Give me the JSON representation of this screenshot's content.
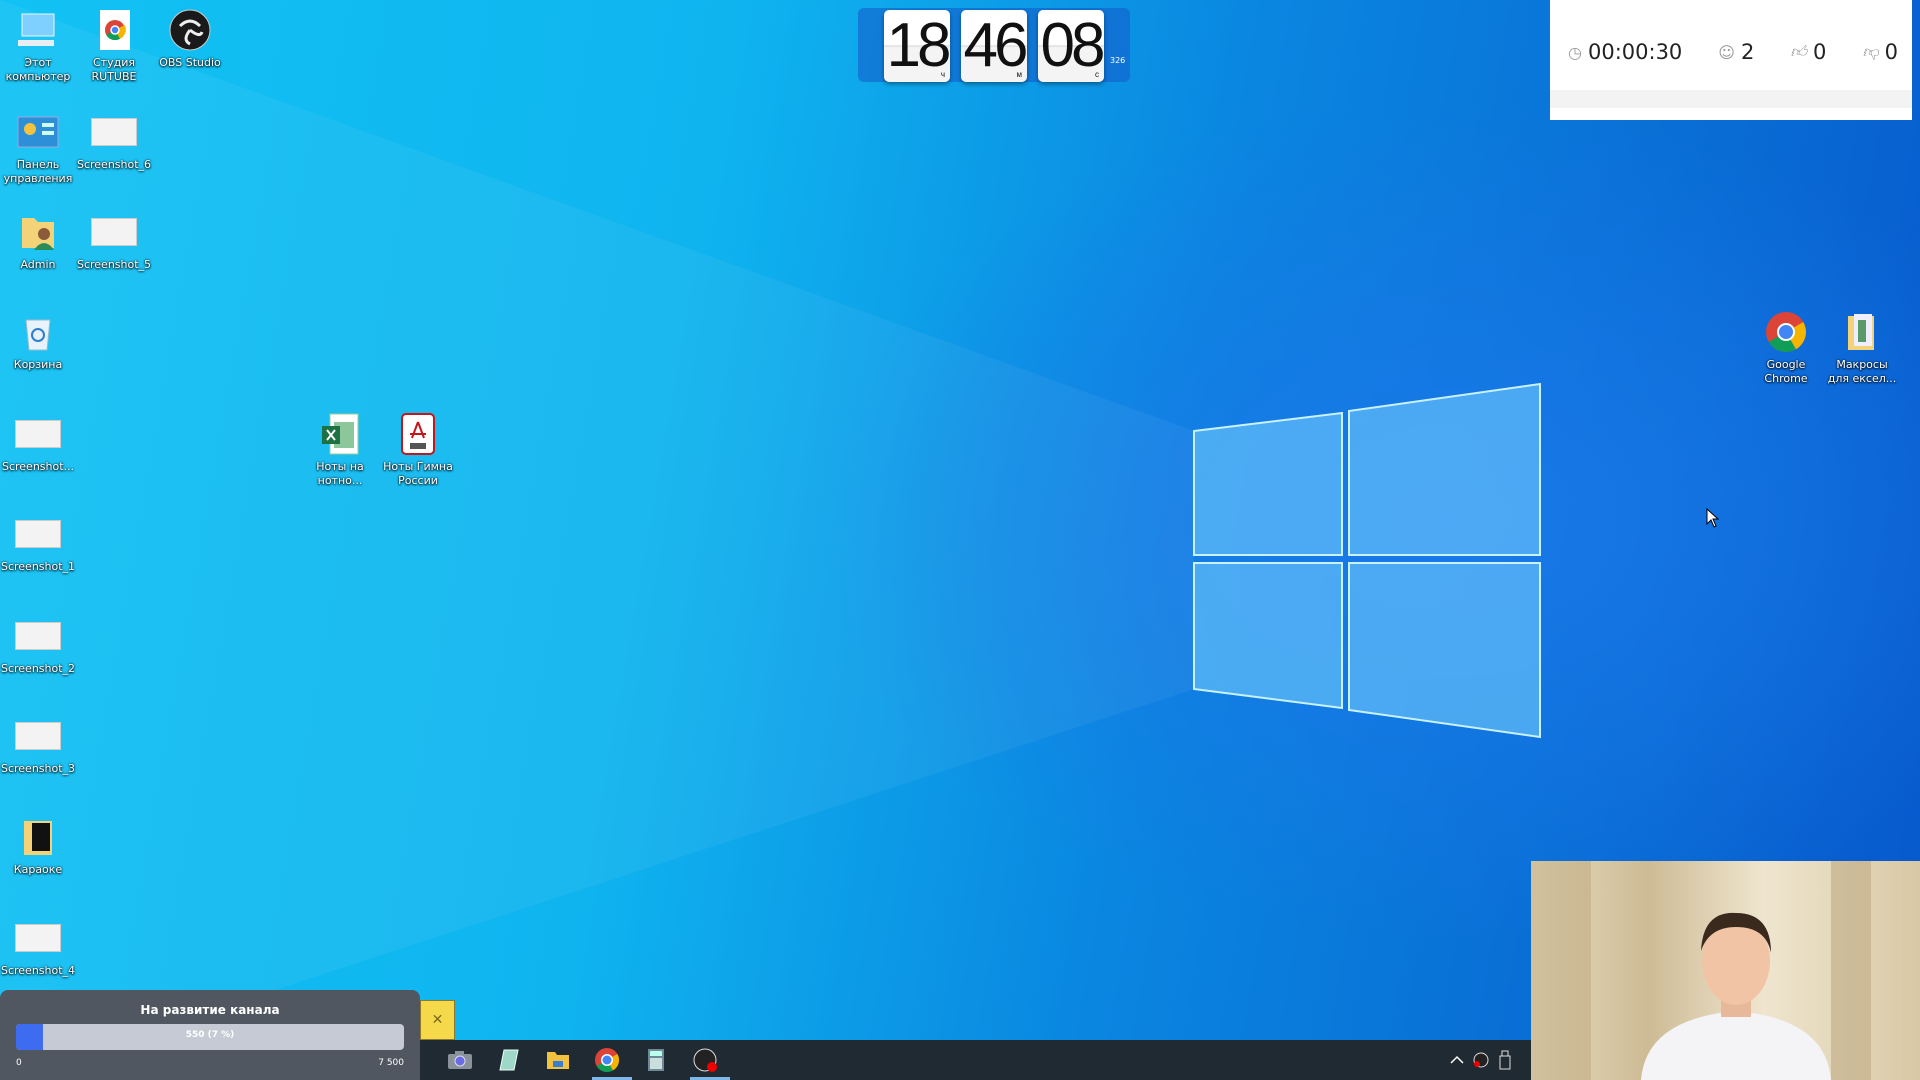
{
  "desktop": {
    "icons_left": [
      {
        "label": "Этот компьютер",
        "icon": "computer-icon"
      },
      {
        "label": "Студия RUTUBE",
        "icon": "chrome-shortcut-icon"
      },
      {
        "label": "OBS Studio",
        "icon": "obs-icon"
      },
      {
        "label": "Панель управления",
        "icon": "control-panel-icon"
      },
      {
        "label": "Screenshot_6",
        "icon": "image-thumbnail-icon"
      },
      {
        "label": "Admin",
        "icon": "user-folder-icon"
      },
      {
        "label": "Screenshot_5",
        "icon": "image-thumbnail-icon"
      },
      {
        "label": "Корзина",
        "icon": "recycle-bin-icon"
      },
      {
        "label": "Screenshot...",
        "icon": "image-thumbnail-icon"
      },
      {
        "label": "Screenshot_1",
        "icon": "image-thumbnail-icon"
      },
      {
        "label": "Screenshot_2",
        "icon": "image-thumbnail-icon"
      },
      {
        "label": "Screenshot_3",
        "icon": "image-thumbnail-icon"
      },
      {
        "label": "Караоке",
        "icon": "folder-icon"
      },
      {
        "label": "Screenshot_4",
        "icon": "image-thumbnail-icon"
      },
      {
        "label": "Ноты на нотно...",
        "icon": "excel-file-icon"
      },
      {
        "label": "Ноты Гимна России",
        "icon": "pdf-file-icon"
      },
      {
        "label": "Google Chrome",
        "icon": "chrome-icon"
      },
      {
        "label": "Макросы для ексел...",
        "icon": "folder-shortcut-icon"
      }
    ]
  },
  "clock": {
    "hours": "18",
    "minutes": "46",
    "seconds": "08",
    "h_unit": "ч",
    "m_unit": "м",
    "s_unit": "с",
    "extra": "326"
  },
  "stream_stats": {
    "duration": "00:00:30",
    "viewers": "2",
    "likes": "0",
    "dislikes": "0"
  },
  "donation": {
    "title": "На развитие канала",
    "progress_label": "550 (7 %)",
    "current": 550,
    "percent": 7,
    "min": "0",
    "max": "7 500",
    "bar_color": "#3d6cf0"
  },
  "taskbar": {
    "apps": [
      "camera-icon",
      "notepad-icon",
      "file-explorer-icon",
      "chrome-icon",
      "calculator-icon",
      "obs-icon"
    ],
    "tray": [
      "chevron-up-icon",
      "obs-tray-icon",
      "usb-icon"
    ]
  }
}
